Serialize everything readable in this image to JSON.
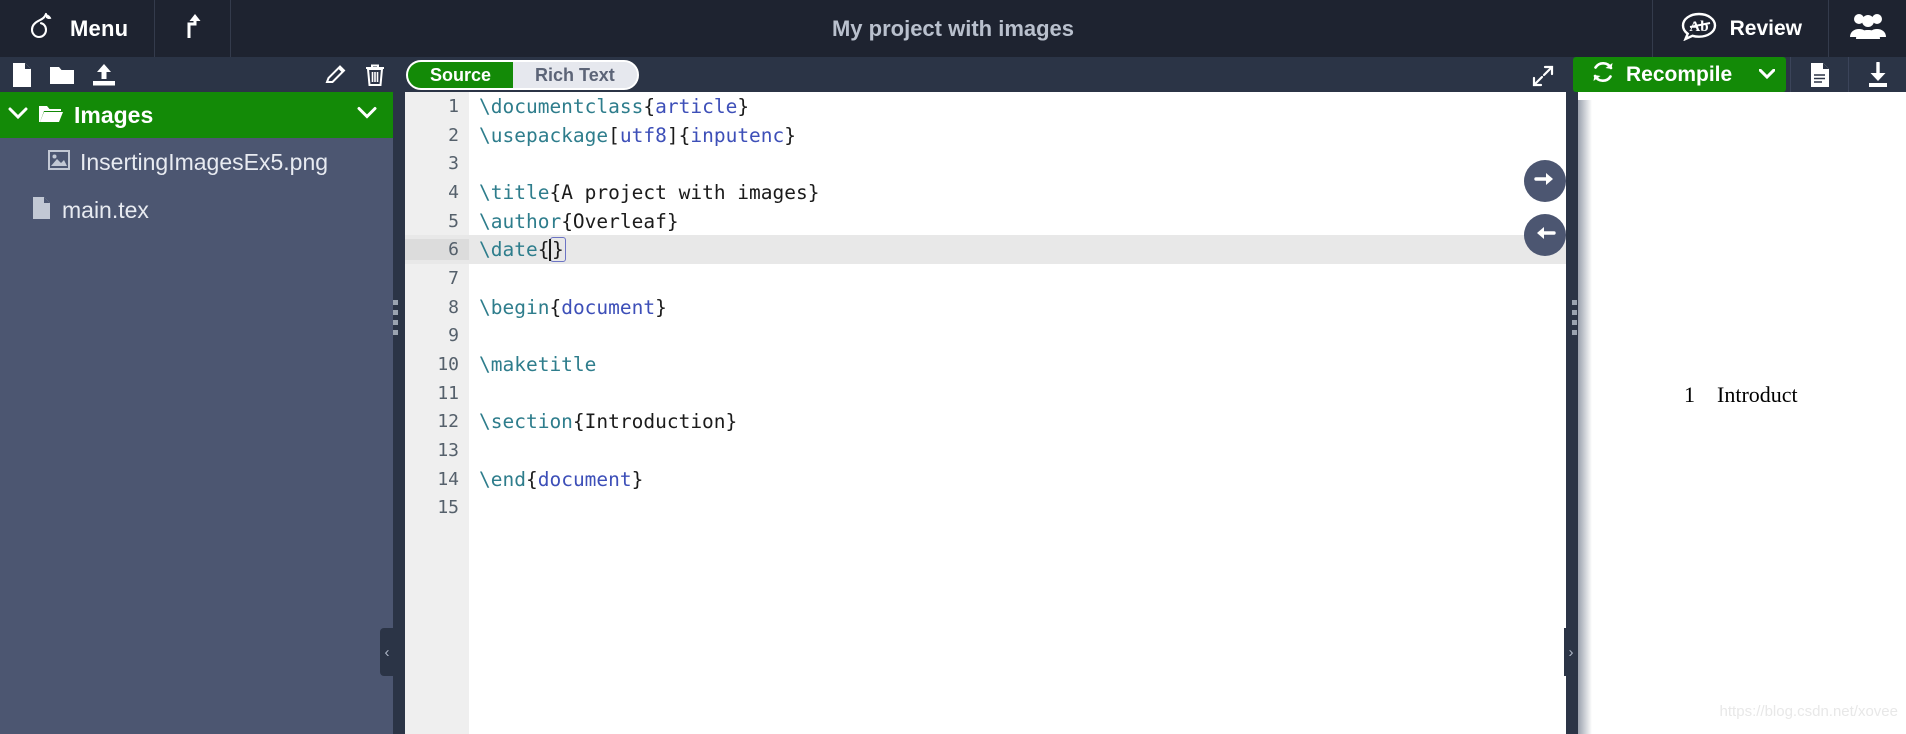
{
  "topbar": {
    "menu_label": "Menu",
    "menu_icon": "overleaf-logo-icon",
    "upload_icon": "upload-arrow-icon",
    "project_title": "My project with images",
    "review_label": "Review",
    "review_icon": "speech-bubble-ab-icon",
    "people_icon": "collaborators-group-icon"
  },
  "toolbar": {
    "new_file_icon": "new-file-icon",
    "new_folder_icon": "new-folder-icon",
    "upload_file_icon": "upload-file-icon",
    "rename_icon": "pencil-edit-icon",
    "delete_icon": "trash-can-icon",
    "mode_source": "Source",
    "mode_rich_text": "Rich Text",
    "active_mode": "Source",
    "expand_icon": "expand-diagonal-icon",
    "recompile_label": "Recompile",
    "recompile_icon": "refresh-circular-icon",
    "recompile_caret_icon": "chevron-down-icon",
    "logs_icon": "document-logs-icon",
    "download_icon": "download-pdf-icon"
  },
  "sidebar": {
    "folder": {
      "name": "Images",
      "expand_caret_icon": "chevron-down-icon",
      "folder_icon": "open-folder-icon",
      "menu_caret_icon": "chevron-down-icon"
    },
    "files": [
      {
        "name": "InsertingImagesEx5.png",
        "icon": "image-file-icon",
        "indent": true,
        "selected": false
      },
      {
        "name": "main.tex",
        "icon": "tex-file-icon",
        "indent": false,
        "selected": false
      }
    ],
    "collapse_icon": "chevron-left-icon"
  },
  "editor": {
    "lines": [
      {
        "num": "1",
        "fold": false,
        "highlight": false,
        "tokens": [
          {
            "t": "\\documentclass",
            "c": "cmd"
          },
          {
            "t": "{",
            "c": "brace"
          },
          {
            "t": "article",
            "c": "arg"
          },
          {
            "t": "}",
            "c": "brace"
          }
        ]
      },
      {
        "num": "2",
        "fold": false,
        "highlight": false,
        "tokens": [
          {
            "t": "\\usepackage",
            "c": "cmd"
          },
          {
            "t": "[",
            "c": "brace"
          },
          {
            "t": "utf8",
            "c": "arg"
          },
          {
            "t": "]",
            "c": "brace"
          },
          {
            "t": "{",
            "c": "brace"
          },
          {
            "t": "inputenc",
            "c": "arg"
          },
          {
            "t": "}",
            "c": "brace"
          }
        ]
      },
      {
        "num": "3",
        "fold": false,
        "highlight": false,
        "tokens": []
      },
      {
        "num": "4",
        "fold": false,
        "highlight": false,
        "tokens": [
          {
            "t": "\\title",
            "c": "cmd"
          },
          {
            "t": "{A project with images}",
            "c": "plain"
          }
        ]
      },
      {
        "num": "5",
        "fold": false,
        "highlight": false,
        "tokens": [
          {
            "t": "\\author",
            "c": "cmd"
          },
          {
            "t": "{Overleaf}",
            "c": "plain"
          }
        ]
      },
      {
        "num": "6",
        "fold": false,
        "highlight": true,
        "tokens": [
          {
            "t": "\\date",
            "c": "cmd"
          },
          {
            "t": "{",
            "c": "brace"
          },
          {
            "t": "CURSOR",
            "c": "cursor"
          },
          {
            "t": "}",
            "c": "matchbox"
          }
        ]
      },
      {
        "num": "7",
        "fold": false,
        "highlight": false,
        "tokens": []
      },
      {
        "num": "8",
        "fold": true,
        "highlight": false,
        "tokens": [
          {
            "t": "\\begin",
            "c": "cmd"
          },
          {
            "t": "{",
            "c": "brace"
          },
          {
            "t": "document",
            "c": "arg"
          },
          {
            "t": "}",
            "c": "brace"
          }
        ]
      },
      {
        "num": "9",
        "fold": false,
        "highlight": false,
        "tokens": []
      },
      {
        "num": "10",
        "fold": false,
        "highlight": false,
        "tokens": [
          {
            "t": "\\maketitle",
            "c": "cmd"
          }
        ]
      },
      {
        "num": "11",
        "fold": false,
        "highlight": false,
        "tokens": []
      },
      {
        "num": "12",
        "fold": true,
        "highlight": false,
        "tokens": [
          {
            "t": "\\section",
            "c": "cmd"
          },
          {
            "t": "{Introduction}",
            "c": "plain"
          }
        ]
      },
      {
        "num": "13",
        "fold": false,
        "highlight": false,
        "tokens": []
      },
      {
        "num": "14",
        "fold": false,
        "highlight": false,
        "tokens": [
          {
            "t": "\\end",
            "c": "cmd"
          },
          {
            "t": "{",
            "c": "brace"
          },
          {
            "t": "document",
            "c": "arg"
          },
          {
            "t": "}",
            "c": "brace"
          }
        ]
      },
      {
        "num": "15",
        "fold": false,
        "highlight": false,
        "tokens": []
      }
    ],
    "nav_next_icon": "arrow-right-icon",
    "nav_prev_icon": "arrow-left-icon",
    "collapse_icon": "chevron-right-icon"
  },
  "pdf": {
    "section_number": "1",
    "section_title": "Introduct",
    "watermark": "https://blog.csdn.net/xovee"
  },
  "colors": {
    "brand_green": "#138a07",
    "topbar_dark": "#1e2330",
    "toolbar_dark": "#2b3446",
    "sidebar_slate": "#4c5671",
    "gutter_gray": "#efefef",
    "cmd_teal": "#2e7d8c",
    "arg_blue": "#3d4fb8"
  }
}
